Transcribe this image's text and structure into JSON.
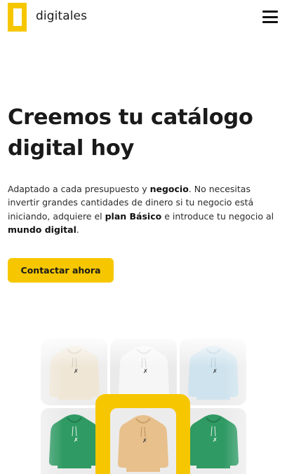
{
  "header": {
    "brand": "digitales",
    "logo_icon": "logo-mark",
    "menu_icon": "hamburger-menu-icon"
  },
  "hero": {
    "title_line1": "Creemos tu catálogo",
    "title_line2": "digital hoy",
    "body": {
      "t1": "Adaptado a cada presupuesto y ",
      "b1": "negocio",
      "t2": ". No necesitas invertir grandes cantidades de dinero si tu negocio está iniciando, adquiere el ",
      "b2": "plan Básico",
      "t3": " e introduce tu negocio al ",
      "b3": "mundo digital",
      "t4": "."
    },
    "cta_label": "Contactar ahora"
  },
  "gallery": {
    "items": [
      {
        "name": "hoodie-cream",
        "color": "#efe6d6"
      },
      {
        "name": "hoodie-white",
        "color": "#f2f2f2"
      },
      {
        "name": "hoodie-light-blue",
        "color": "#cfe3ee"
      },
      {
        "name": "hoodie-green-left",
        "color": "#2f9a64"
      },
      {
        "name": "hoodie-tan-featured",
        "color": "#e8c08c"
      },
      {
        "name": "hoodie-green-right",
        "color": "#2f9a64"
      }
    ],
    "accent": "#f6c700"
  },
  "colors": {
    "accent": "#f6c700",
    "text": "#1a1a1a"
  }
}
